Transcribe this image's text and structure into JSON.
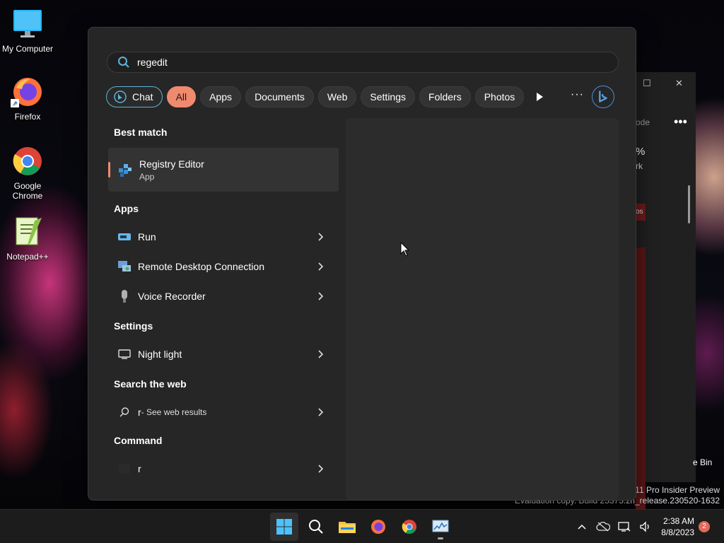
{
  "desktop": {
    "icons": [
      {
        "label": "My Computer"
      },
      {
        "label": "Firefox"
      },
      {
        "label": "Google Chrome"
      },
      {
        "label": "Notepad++"
      }
    ],
    "recycle_label": "e Bin",
    "watermark_line1": "s 11 Pro Insider Preview",
    "watermark_line2": "Evaluation copy. Build 25375.zn_release.230520-1632"
  },
  "background_window": {
    "header_text": "ode",
    "percent_text": "%",
    "col_text": "rk",
    "row_text": "os"
  },
  "search": {
    "value": "regedit",
    "filters": [
      {
        "label": "Chat"
      },
      {
        "label": "All"
      },
      {
        "label": "Apps"
      },
      {
        "label": "Documents"
      },
      {
        "label": "Web"
      },
      {
        "label": "Settings"
      },
      {
        "label": "Folders"
      },
      {
        "label": "Photos"
      }
    ],
    "more_label": "···"
  },
  "results": {
    "best_match_title": "Best match",
    "best_match": {
      "name": "Registry Editor",
      "type": "App"
    },
    "apps_title": "Apps",
    "apps": [
      {
        "name": "Run"
      },
      {
        "name": "Remote Desktop Connection"
      },
      {
        "name": "Voice Recorder"
      }
    ],
    "settings_title": "Settings",
    "settings": [
      {
        "name": "Night light"
      }
    ],
    "web_title": "Search the web",
    "web": {
      "query": "r",
      "suffix": " - See web results"
    },
    "command_title": "Command",
    "command": {
      "name": "r"
    }
  },
  "taskbar": {
    "time": "2:38 AM",
    "date": "8/8/2023",
    "notification_count": "2"
  },
  "colors": {
    "accent": "#f08a6e",
    "chat_border": "#5fb3d6",
    "panel_bg": "#262626"
  }
}
